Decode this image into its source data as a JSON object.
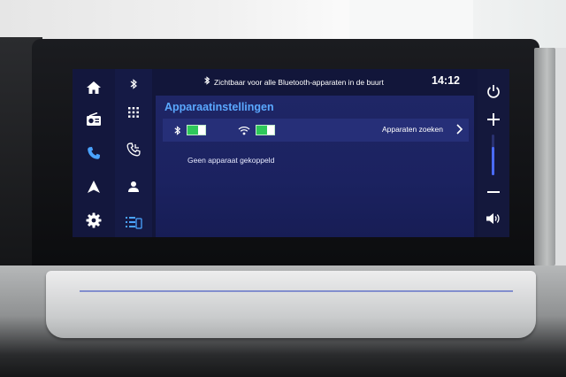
{
  "status_bar": {
    "bluetooth_message": "Zichtbaar voor alle Bluetooth-apparaten in de buurt",
    "time": "14:12"
  },
  "left_rail": {
    "items": [
      {
        "icon": "home-icon"
      },
      {
        "icon": "radio-icon"
      },
      {
        "icon": "phone-icon",
        "active": true
      },
      {
        "icon": "navigation-icon"
      },
      {
        "icon": "settings-icon"
      }
    ]
  },
  "phone_menu": {
    "items": [
      {
        "icon": "bluetooth-icon"
      },
      {
        "icon": "keypad-icon"
      },
      {
        "icon": "call-log-icon"
      },
      {
        "icon": "contacts-icon"
      },
      {
        "icon": "device-list-icon",
        "active": true
      }
    ]
  },
  "settings_page": {
    "title": "Apparaatinstellingen",
    "bluetooth_toggle": {
      "icon": "bluetooth-icon",
      "on": true
    },
    "wifi_toggle": {
      "icon": "wifi-icon",
      "on": true
    },
    "search_devices_label": "Apparaten zoeken",
    "empty_message": "Geen apparaat gekoppeld"
  },
  "right_rail": {
    "power": "power-icon",
    "volume_up": "plus-icon",
    "volume_down": "minus-icon",
    "audio": "speaker-icon",
    "volume_level": 0.7
  },
  "colors": {
    "accent": "#5aa8ff",
    "toggle_on": "#2ec85a",
    "active_icon": "#4aa3ff"
  }
}
